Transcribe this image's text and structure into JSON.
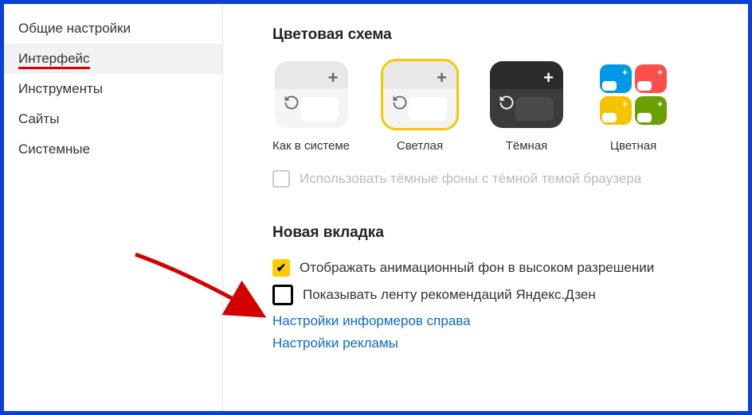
{
  "sidebar": {
    "items": [
      {
        "label": "Общие настройки"
      },
      {
        "label": "Интерфейс"
      },
      {
        "label": "Инструменты"
      },
      {
        "label": "Сайты"
      },
      {
        "label": "Системные"
      }
    ]
  },
  "color_scheme": {
    "title": "Цветовая схема",
    "themes": [
      {
        "label": "Как в системе"
      },
      {
        "label": "Светлая"
      },
      {
        "label": "Тёмная"
      },
      {
        "label": "Цветная"
      }
    ],
    "dark_bg_label": "Использовать тёмные фоны с тёмной темой браузера"
  },
  "new_tab": {
    "title": "Новая вкладка",
    "anim_label": "Отображать анимационный фон в высоком разрешении",
    "zen_label": "Показывать ленту рекомендаций Яндекс.Дзен",
    "link1": "Настройки информеров справа",
    "link2": "Настройки рекламы"
  }
}
